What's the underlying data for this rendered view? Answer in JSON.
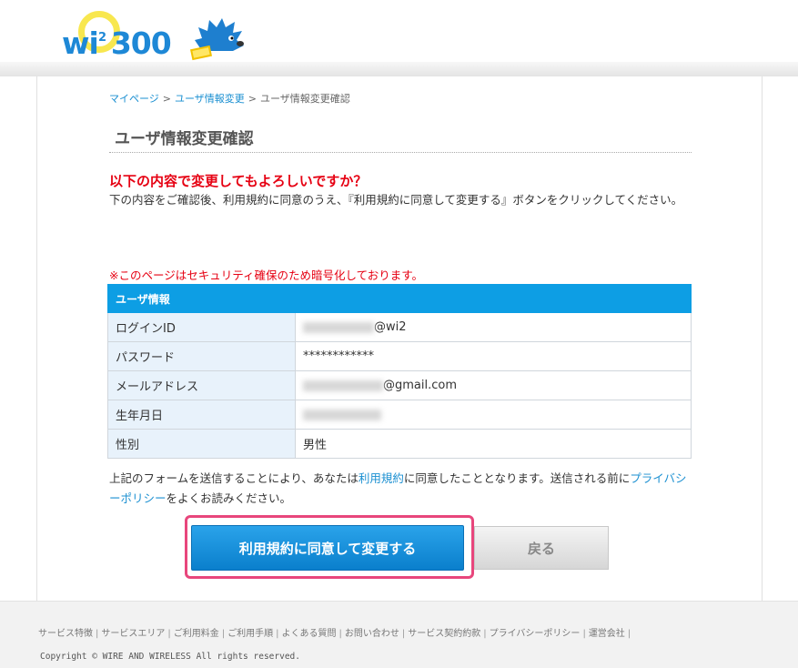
{
  "header": {
    "logo_wi": "wi",
    "logo_sup": "2",
    "logo_num": "300"
  },
  "breadcrumb": {
    "items": [
      "マイページ",
      "ユーザ情報変更",
      "ユーザ情報変更確認"
    ],
    "separator": ">"
  },
  "page": {
    "title": "ユーザ情報変更確認",
    "question": "以下の内容で変更してもよろしいですか？",
    "description": "下の内容をご確認後、利用規約に同意のうえ、『利用規約に同意して変更する』ボタンをクリックしてください。",
    "security_note": "※このページはセキュリティ確保のため暗号化しております。"
  },
  "table": {
    "header": "ユーザ情報",
    "rows": [
      {
        "label": "ログインID",
        "value": "@wi2"
      },
      {
        "label": "パスワード",
        "value": "************"
      },
      {
        "label": "メールアドレス",
        "value": "@gmail.com"
      },
      {
        "label": "生年月日",
        "value": ""
      },
      {
        "label": "性別",
        "value": "男性"
      }
    ]
  },
  "notice": {
    "part1": "上記のフォームを送信することにより、あなたは",
    "terms_link": "利用規約",
    "part2": "に同意したこととなります。送信される前に",
    "privacy_link": "プライバシーポリシー",
    "part3": "をよくお読みください。"
  },
  "buttons": {
    "agree": "利用規約に同意して変更する",
    "back": "戻る"
  },
  "footer": {
    "links": [
      "サービス特徴",
      "サービスエリア",
      "ご利用料金",
      "ご利用手順",
      "よくある質問",
      "お問い合わせ",
      "サービス契約約款",
      "プライバシーポリシー",
      "運営会社"
    ],
    "copyright": "Copyright © WIRE AND WIRELESS All rights reserved."
  },
  "colors": {
    "accent": "#0d9ee4",
    "warning": "#e60012",
    "highlight": "#e8467c"
  }
}
